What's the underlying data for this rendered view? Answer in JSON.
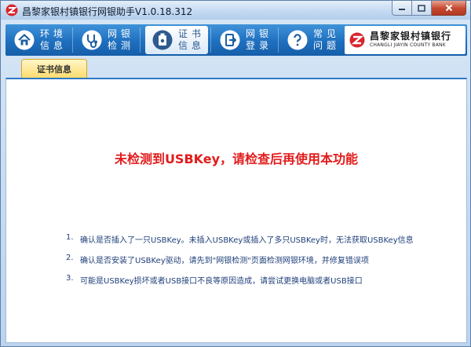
{
  "window": {
    "title": "昌黎家银村镇银行网银助手V1.0.18.312"
  },
  "nav": {
    "items": [
      {
        "key": "env",
        "label": "环境信息",
        "icon": "house-icon"
      },
      {
        "key": "check",
        "label": "网银检测",
        "icon": "stethoscope-icon"
      },
      {
        "key": "cert",
        "label": "证书信息",
        "icon": "usb-key-icon",
        "active": true
      },
      {
        "key": "login",
        "label": "网银登录",
        "icon": "login-icon"
      },
      {
        "key": "faq",
        "label": "常见问题",
        "icon": "question-icon"
      }
    ]
  },
  "brand": {
    "name_cn": "昌黎家银村镇银行",
    "name_en": "CHANGLI JIAYIN COUNTY BANK"
  },
  "tabs": [
    "证书信息"
  ],
  "content": {
    "headline": "未检测到USBKey，请检查后再使用本功能",
    "tips": [
      {
        "num": "1.",
        "text": "确认是否插入了一只USBKey。未插入USBKey或插入了多只USBKey时，无法获取USBKey信息"
      },
      {
        "num": "2.",
        "text": "确认是否安装了USBKey驱动，请先到\"网银检测\"页面检测网银环境，并修复错误项"
      },
      {
        "num": "3.",
        "text": "可能是USBKey损坏或者USB接口不良等原因造成，请尝试更换电脑或者USB接口"
      }
    ]
  },
  "colors": {
    "nav_blue": "#1f6fbf",
    "headline_red": "#e31b1b",
    "tip_blue": "#1f3f7a",
    "tab_yellow": "#fddc6e"
  }
}
